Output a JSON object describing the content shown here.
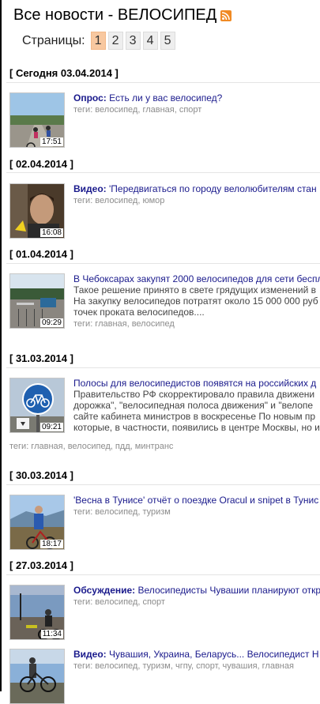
{
  "page": {
    "title": "Все новости - ВЕЛОСИПЕД",
    "rss_icon": "rss-icon"
  },
  "pager": {
    "label": "Страницы:",
    "pages": [
      "1",
      "2",
      "3",
      "4",
      "5"
    ],
    "current": "1"
  },
  "colors": {
    "headline": "#1a1a8c",
    "tags": "#8c8c8c",
    "active_page": "#f8c8a0",
    "rss": "#f08a24"
  },
  "sections": [
    {
      "date": "[ Сегодня 03.04.2014 ]",
      "items": [
        {
          "duration": "17:51",
          "prefix": "Опрос:",
          "title": " Есть ли у вас велосипед?",
          "desc": [],
          "tags": "теги: велосипед, главная, спорт"
        }
      ]
    },
    {
      "date": "[ 02.04.2014 ]",
      "items": [
        {
          "duration": "16:08",
          "prefix": "Видео:",
          "title": " 'Передвигаться по городу велолюбителям стан",
          "desc": [],
          "tags": "теги: велосипед, юмор"
        }
      ]
    },
    {
      "date": "[ 01.04.2014 ]",
      "items": [
        {
          "duration": "09:29",
          "prefix": "",
          "title": "В Чебоксарах закупят 2000 велосипедов для сети беспл",
          "desc": [
            "Такое решение принято в свете грядущих изменений в",
            "На закупку велосипедов потратят около 15 000 000 руб",
            "точек проката велосипедов...."
          ],
          "tags": "теги: главная, велосипед"
        }
      ]
    },
    {
      "date": "[ 31.03.2014 ]",
      "items": [
        {
          "duration": "09:21",
          "prefix": "",
          "title": "Полосы для велосипедистов появятся на российских д",
          "desc": [
            "Правительство РФ скорректировало правила движени",
            "дорожка\", \"велосипедная полоса движения\" и \"велопе",
            "сайте кабинета министров в воскресенье По новым пр",
            "которые, в частности, появились в центре Москвы, но и"
          ],
          "tags": "теги: главная, велосипед, пдд, минтранс"
        }
      ]
    },
    {
      "date": "[ 30.03.2014 ]",
      "items": [
        {
          "duration": "18:17",
          "prefix": "",
          "title": "'Весна в Тунисе' отчёт о поездке Oracul и snipet в Тунис",
          "desc": [],
          "tags": "теги: велосипед, туризм"
        }
      ]
    },
    {
      "date": "[ 27.03.2014 ]",
      "items": [
        {
          "duration": "11:34",
          "prefix": "Обсуждение:",
          "title": " Велосипедисты Чувашии планируют откр",
          "desc": [],
          "tags": "теги: велосипед, спорт"
        },
        {
          "duration": "",
          "prefix": "Видео:",
          "title": " Чувашия, Украина, Беларусь... Велосипедист Н",
          "desc": [],
          "tags": "теги: велосипед, туризм, чгпу, спорт, чувашия, главная"
        }
      ]
    }
  ]
}
